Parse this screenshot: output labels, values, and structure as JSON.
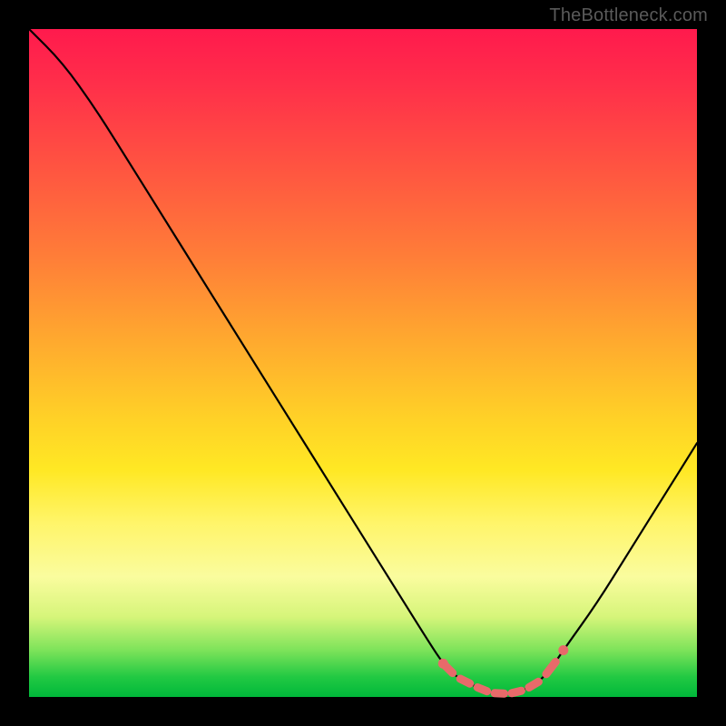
{
  "watermark": "TheBottleneck.com",
  "colors": {
    "background": "#000000",
    "curve": "#000000",
    "markers": "#e86a6a",
    "gradient_top": "#ff1a4d",
    "gradient_bottom": "#00b83a"
  },
  "chart_data": {
    "type": "line",
    "title": "",
    "xlabel": "",
    "ylabel": "",
    "xlim": [
      0,
      100
    ],
    "ylim": [
      0,
      100
    ],
    "x": [
      0,
      5,
      10,
      15,
      20,
      25,
      30,
      35,
      40,
      45,
      50,
      55,
      60,
      62,
      64,
      66,
      68,
      70,
      72,
      74,
      76,
      78,
      80,
      85,
      90,
      95,
      100
    ],
    "values": [
      100,
      95,
      88,
      80,
      72,
      64,
      56,
      48,
      40,
      32,
      24,
      16,
      8,
      5,
      3,
      2,
      1,
      0.5,
      0.5,
      1,
      2,
      4,
      7,
      14,
      22,
      30,
      38
    ],
    "minimum_region_x": [
      62,
      80
    ],
    "series": [
      {
        "name": "bottleneck-curve",
        "x": [
          0,
          5,
          10,
          15,
          20,
          25,
          30,
          35,
          40,
          45,
          50,
          55,
          60,
          62,
          64,
          66,
          68,
          70,
          72,
          74,
          76,
          78,
          80,
          85,
          90,
          95,
          100
        ],
        "values": [
          100,
          95,
          88,
          80,
          72,
          64,
          56,
          48,
          40,
          32,
          24,
          16,
          8,
          5,
          3,
          2,
          1,
          0.5,
          0.5,
          1,
          2,
          4,
          7,
          14,
          22,
          30,
          38
        ]
      }
    ]
  }
}
